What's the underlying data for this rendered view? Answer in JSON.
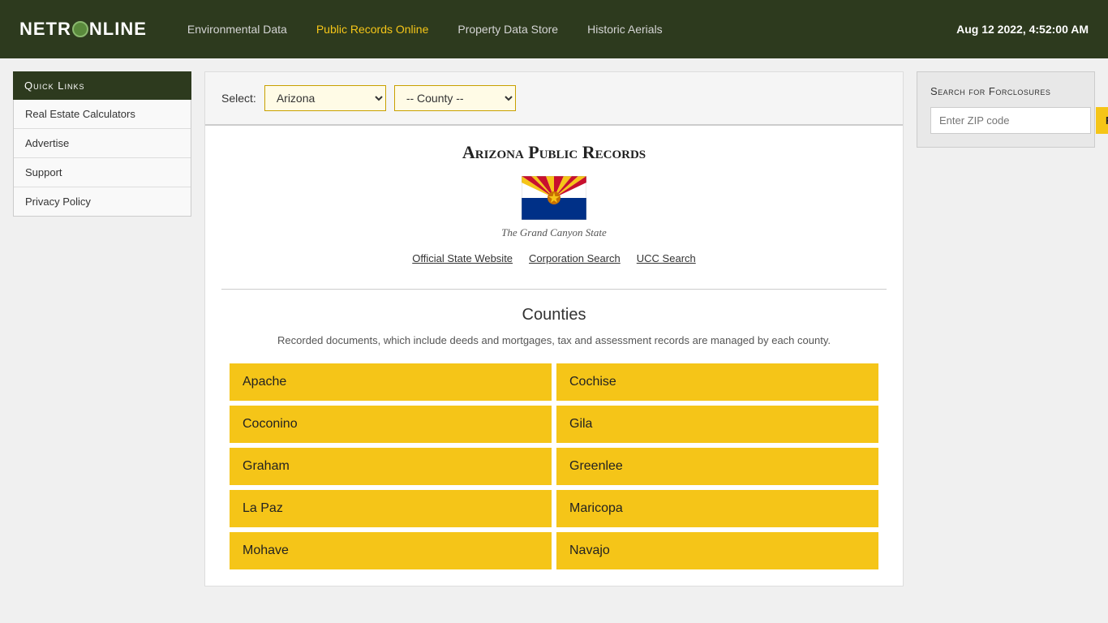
{
  "header": {
    "logo": "NETRONLINE",
    "nav_items": [
      {
        "label": "Environmental Data",
        "active": false
      },
      {
        "label": "Public Records Online",
        "active": true
      },
      {
        "label": "Property Data Store",
        "active": false
      },
      {
        "label": "Historic Aerials",
        "active": false
      }
    ],
    "datetime": "Aug 12 2022, 4:52:00 AM"
  },
  "sidebar": {
    "quick_links_label": "Quick Links",
    "items": [
      {
        "label": "Real Estate Calculators"
      },
      {
        "label": "Advertise"
      },
      {
        "label": "Support"
      },
      {
        "label": "Privacy Policy"
      }
    ]
  },
  "select_bar": {
    "label": "Select:",
    "state_value": "Arizona",
    "county_placeholder": "-- County --",
    "state_options": [
      "Arizona"
    ],
    "county_options": [
      "-- County --"
    ]
  },
  "state_section": {
    "title": "Arizona Public Records",
    "nickname": "The Grand Canyon State",
    "links": [
      {
        "label": "Official State Website"
      },
      {
        "label": "Corporation Search"
      },
      {
        "label": "UCC Search"
      }
    ]
  },
  "counties_section": {
    "title": "Counties",
    "description": "Recorded documents, which include deeds and mortgages, tax and assessment records are managed by each county.",
    "counties": [
      {
        "name": "Apache"
      },
      {
        "name": "Cochise"
      },
      {
        "name": "Coconino"
      },
      {
        "name": "Gila"
      },
      {
        "name": "Graham"
      },
      {
        "name": "Greenlee"
      },
      {
        "name": "La Paz"
      },
      {
        "name": "Maricopa"
      },
      {
        "name": "Mohave"
      },
      {
        "name": "Navajo"
      }
    ]
  },
  "foreclosure_box": {
    "title": "Search for Forclosures",
    "input_placeholder": "Enter ZIP code",
    "button_label": "Find!"
  }
}
